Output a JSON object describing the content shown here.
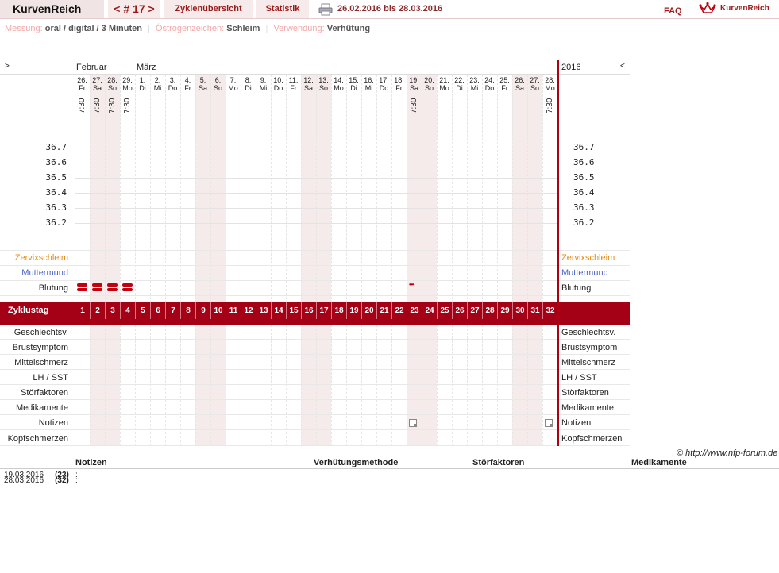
{
  "topbar": {
    "brand": "KurvenReich",
    "cycle": "< # 17 >",
    "overview": "Zyklenübersicht",
    "stats": "Statistik",
    "daterange": "26.02.2016 bis 28.03.2016",
    "faq": "FAQ",
    "logo_text": "KurvenReich"
  },
  "info": {
    "messung_label": "Messung:",
    "messung_value": "oral / digital / 3 Minuten",
    "oestrogen_label": "Östrogenzeichen:",
    "oestrogen_value": "Schleim",
    "verwendung_label": "Verwendung:",
    "verwendung_value": "Verhütung"
  },
  "chart": {
    "nav_left": ">",
    "nav_right": "<",
    "year": "2016",
    "months": [
      "Februar",
      "März"
    ],
    "days": [
      {
        "d": "26.",
        "w": "Fr",
        "t": "7:30",
        "we": false
      },
      {
        "d": "27.",
        "w": "Sa",
        "t": "7:30",
        "we": true
      },
      {
        "d": "28.",
        "w": "So",
        "t": "7:30",
        "we": true
      },
      {
        "d": "29.",
        "w": "Mo",
        "t": "7:30",
        "we": false
      },
      {
        "d": "1.",
        "w": "Di",
        "t": "",
        "we": false
      },
      {
        "d": "2.",
        "w": "Mi",
        "t": "",
        "we": false
      },
      {
        "d": "3.",
        "w": "Do",
        "t": "",
        "we": false
      },
      {
        "d": "4.",
        "w": "Fr",
        "t": "",
        "we": false
      },
      {
        "d": "5.",
        "w": "Sa",
        "t": "",
        "we": true
      },
      {
        "d": "6.",
        "w": "So",
        "t": "",
        "we": true
      },
      {
        "d": "7.",
        "w": "Mo",
        "t": "",
        "we": false
      },
      {
        "d": "8.",
        "w": "Di",
        "t": "",
        "we": false
      },
      {
        "d": "9.",
        "w": "Mi",
        "t": "",
        "we": false
      },
      {
        "d": "10.",
        "w": "Do",
        "t": "",
        "we": false
      },
      {
        "d": "11.",
        "w": "Fr",
        "t": "",
        "we": false
      },
      {
        "d": "12.",
        "w": "Sa",
        "t": "",
        "we": true
      },
      {
        "d": "13.",
        "w": "So",
        "t": "",
        "we": true
      },
      {
        "d": "14.",
        "w": "Mo",
        "t": "",
        "we": false
      },
      {
        "d": "15.",
        "w": "Di",
        "t": "",
        "we": false
      },
      {
        "d": "16.",
        "w": "Mi",
        "t": "",
        "we": false
      },
      {
        "d": "17.",
        "w": "Do",
        "t": "",
        "we": false
      },
      {
        "d": "18.",
        "w": "Fr",
        "t": "",
        "we": false
      },
      {
        "d": "19.",
        "w": "Sa",
        "t": "7:30",
        "we": true
      },
      {
        "d": "20.",
        "w": "So",
        "t": "",
        "we": true
      },
      {
        "d": "21.",
        "w": "Mo",
        "t": "",
        "we": false
      },
      {
        "d": "22.",
        "w": "Di",
        "t": "",
        "we": false
      },
      {
        "d": "23.",
        "w": "Mi",
        "t": "",
        "we": false
      },
      {
        "d": "24.",
        "w": "Do",
        "t": "",
        "we": false
      },
      {
        "d": "25.",
        "w": "Fr",
        "t": "",
        "we": false
      },
      {
        "d": "26.",
        "w": "Sa",
        "t": "",
        "we": true
      },
      {
        "d": "27.",
        "w": "So",
        "t": "",
        "we": true
      },
      {
        "d": "28.",
        "w": "Mo",
        "t": "7:30",
        "we": false
      }
    ],
    "temperatures": [
      "36.7",
      "36.6",
      "36.5",
      "36.4",
      "36.3",
      "36.2"
    ],
    "rows": {
      "zervix": "Zervixschleim",
      "muttermund": "Muttermund",
      "blutung": "Blutung",
      "zyklustag": "Zyklustag",
      "geschlecht": "Geschlechtsv.",
      "brust": "Brustsymptom",
      "mittel": "Mittelschmerz",
      "lh": "LH / SST",
      "stoer": "Störfaktoren",
      "medikamente": "Medikamente",
      "notizen": "Notizen",
      "kopf": "Kopfschmerzen"
    },
    "cycle_days": [
      "1",
      "2",
      "3",
      "4",
      "5",
      "6",
      "7",
      "8",
      "9",
      "10",
      "11",
      "12",
      "13",
      "14",
      "15",
      "16",
      "17",
      "18",
      "19",
      "20",
      "21",
      "22",
      "23",
      "24",
      "25",
      "26",
      "27",
      "28",
      "29",
      "30",
      "31",
      "32"
    ],
    "bleeding_heavy_days": [
      1,
      2,
      3,
      4
    ],
    "spotting_day": 23,
    "notes_days": [
      23,
      32
    ]
  },
  "copyright": "© http://www.nfp-forum.de",
  "notes_table": {
    "headers": [
      "Notizen",
      "Verhütungsmethode",
      "Störfaktoren",
      "Medikamente"
    ],
    "rows": [
      {
        "date": "19.03.2016",
        "day": "(23)",
        "text": ":"
      },
      {
        "date": "28.03.2016",
        "day": "(32)",
        "text": ":"
      }
    ]
  }
}
